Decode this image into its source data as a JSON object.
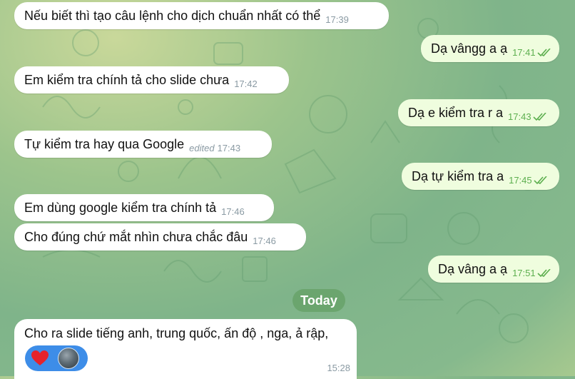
{
  "messages": [
    {
      "text": "Nếu biết thì tạo câu lệnh cho dịch chuẩn nhất có thể",
      "time": "17:39",
      "dir": "in"
    },
    {
      "text": "Dạ vângg a ạ",
      "time": "17:41",
      "dir": "out"
    },
    {
      "text": "Em kiểm tra chính tả cho slide chưa",
      "time": "17:42",
      "dir": "in"
    },
    {
      "text": "Dạ e kiểm tra r a",
      "time": "17:43",
      "dir": "out"
    },
    {
      "text": "Tự kiểm tra hay qua Google",
      "edited": "edited",
      "time": "17:43",
      "dir": "in"
    },
    {
      "text": "Dạ tự kiểm tra a",
      "time": "17:45",
      "dir": "out"
    },
    {
      "text": "Em dùng google kiểm tra chính tả",
      "time": "17:46",
      "dir": "in"
    },
    {
      "text": "Cho đúng chứ mắt nhìn chưa chắc đâu",
      "time": "17:46",
      "dir": "in"
    },
    {
      "text": "Dạ vâng a ạ",
      "time": "17:51",
      "dir": "out"
    }
  ],
  "date_separator": "Today",
  "last_message": {
    "text": "Cho ra slide tiếng anh, trung quốc, ấn độ , nga, ả rập,",
    "time": "15:28",
    "reaction_icon": "heart-icon",
    "reaction_color": "#e5232b"
  },
  "colors": {
    "incoming_bubble": "#ffffff",
    "outgoing_bubble": "#effdde",
    "read_ticks": "#5daf4f",
    "reaction_pill": "#3d8de8"
  }
}
